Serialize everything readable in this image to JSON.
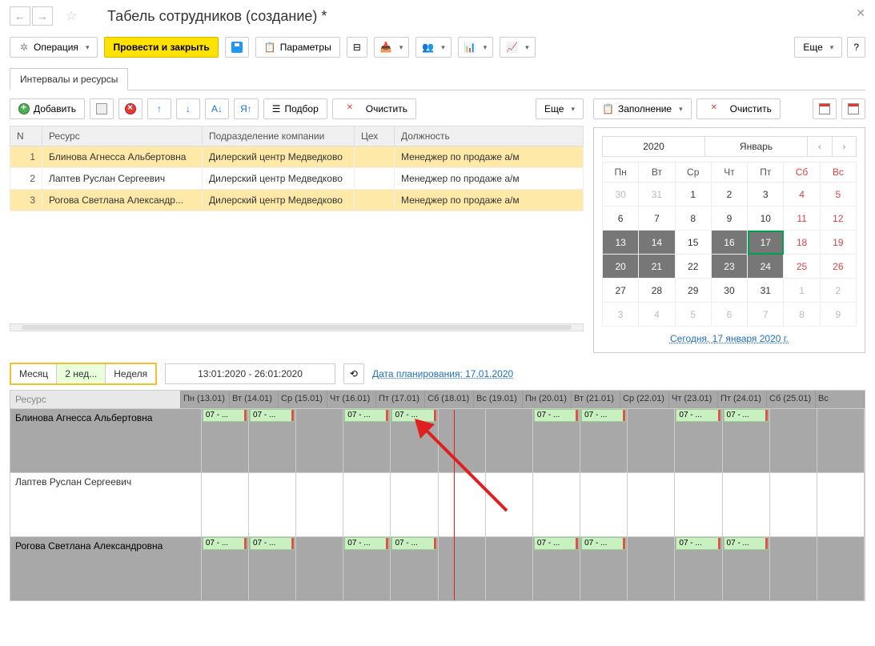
{
  "header": {
    "title": "Табель сотрудников (создание) *"
  },
  "toolbar": {
    "operation": "Операция",
    "post_close": "Провести и закрыть",
    "parameters": "Параметры",
    "more": "Еще"
  },
  "tabs": {
    "intervals": "Интервалы и ресурсы"
  },
  "sub_toolbar": {
    "add": "Добавить",
    "pick": "Подбор",
    "clear": "Очистить",
    "more": "Еще",
    "fill": "Заполнение",
    "clear2": "Очистить"
  },
  "grid": {
    "cols": {
      "n": "N",
      "resource": "Ресурс",
      "division": "Подразделение компании",
      "shop": "Цех",
      "position": "Должность"
    },
    "rows": [
      {
        "n": "1",
        "resource": "Блинова Агнесса Альбертовна",
        "division": "Дилерский центр Медведково",
        "shop": "",
        "position": "Менеджер по продаже а/м"
      },
      {
        "n": "2",
        "resource": "Лаптев Руслан Сергеевич",
        "division": "Дилерский центр Медведково",
        "shop": "",
        "position": "Менеджер по продаже а/м"
      },
      {
        "n": "3",
        "resource": "Рогова Светлана Александр...",
        "division": "Дилерский центр Медведково",
        "shop": "",
        "position": "Менеджер по продаже а/м"
      }
    ]
  },
  "calendar": {
    "year": "2020",
    "month": "Январь",
    "dow": [
      "Пн",
      "Вт",
      "Ср",
      "Чт",
      "Пт",
      "Сб",
      "Вс"
    ],
    "weeks": [
      [
        {
          "d": "30",
          "g": true
        },
        {
          "d": "31",
          "g": true
        },
        {
          "d": "1"
        },
        {
          "d": "2"
        },
        {
          "d": "3"
        },
        {
          "d": "4",
          "we": true
        },
        {
          "d": "5",
          "we": true
        }
      ],
      [
        {
          "d": "6"
        },
        {
          "d": "7"
        },
        {
          "d": "8"
        },
        {
          "d": "9"
        },
        {
          "d": "10"
        },
        {
          "d": "11",
          "we": true
        },
        {
          "d": "12",
          "we": true
        }
      ],
      [
        {
          "d": "13",
          "dk": true
        },
        {
          "d": "14",
          "dk": true
        },
        {
          "d": "15"
        },
        {
          "d": "16",
          "dk": true
        },
        {
          "d": "17",
          "dk": true,
          "t": true
        },
        {
          "d": "18",
          "we": true
        },
        {
          "d": "19",
          "we": true
        }
      ],
      [
        {
          "d": "20",
          "dk": true
        },
        {
          "d": "21",
          "dk": true
        },
        {
          "d": "22"
        },
        {
          "d": "23",
          "dk": true
        },
        {
          "d": "24",
          "dk": true
        },
        {
          "d": "25",
          "we": true
        },
        {
          "d": "26",
          "we": true
        }
      ],
      [
        {
          "d": "27"
        },
        {
          "d": "28"
        },
        {
          "d": "29"
        },
        {
          "d": "30"
        },
        {
          "d": "31"
        },
        {
          "d": "1",
          "g": true
        },
        {
          "d": "2",
          "g": true
        }
      ],
      [
        {
          "d": "3",
          "g": true
        },
        {
          "d": "4",
          "g": true
        },
        {
          "d": "5",
          "g": true
        },
        {
          "d": "6",
          "g": true
        },
        {
          "d": "7",
          "g": true
        },
        {
          "d": "8",
          "g": true
        },
        {
          "d": "9",
          "g": true
        }
      ]
    ],
    "today_link": "Сегодня, 17 января 2020 г."
  },
  "sched_controls": {
    "month": "Месяц",
    "two_weeks": "2 нед...",
    "week": "Неделя",
    "range": "13:01:2020 - 26:01:2020",
    "plan_link": "Дата планирования: 17.01.2020"
  },
  "schedule": {
    "res_header": "Ресурс",
    "days": [
      "Пн (13.01)",
      "Вт (14.01)",
      "Ср (15.01)",
      "Чт (16.01)",
      "Пт (17.01)",
      "Сб (18.01)",
      "Вс (19.01)",
      "Пн (20.01)",
      "Вт (21.01)",
      "Ср (22.01)",
      "Чт (23.01)",
      "Пт (24.01)",
      "Сб (25.01)",
      "Вс"
    ],
    "slot_text": "07 - ...",
    "rows": [
      {
        "name": "Блинова Агнесса Альбертовна",
        "gray": true,
        "slots": [
          0,
          1,
          3,
          4,
          7,
          8,
          10,
          11
        ]
      },
      {
        "name": "Лаптев Руслан Сергеевич",
        "gray": false,
        "slots": []
      },
      {
        "name": "Рогова Светлана Александровна",
        "gray": true,
        "slots": [
          0,
          1,
          3,
          4,
          7,
          8,
          10,
          11
        ]
      }
    ]
  }
}
